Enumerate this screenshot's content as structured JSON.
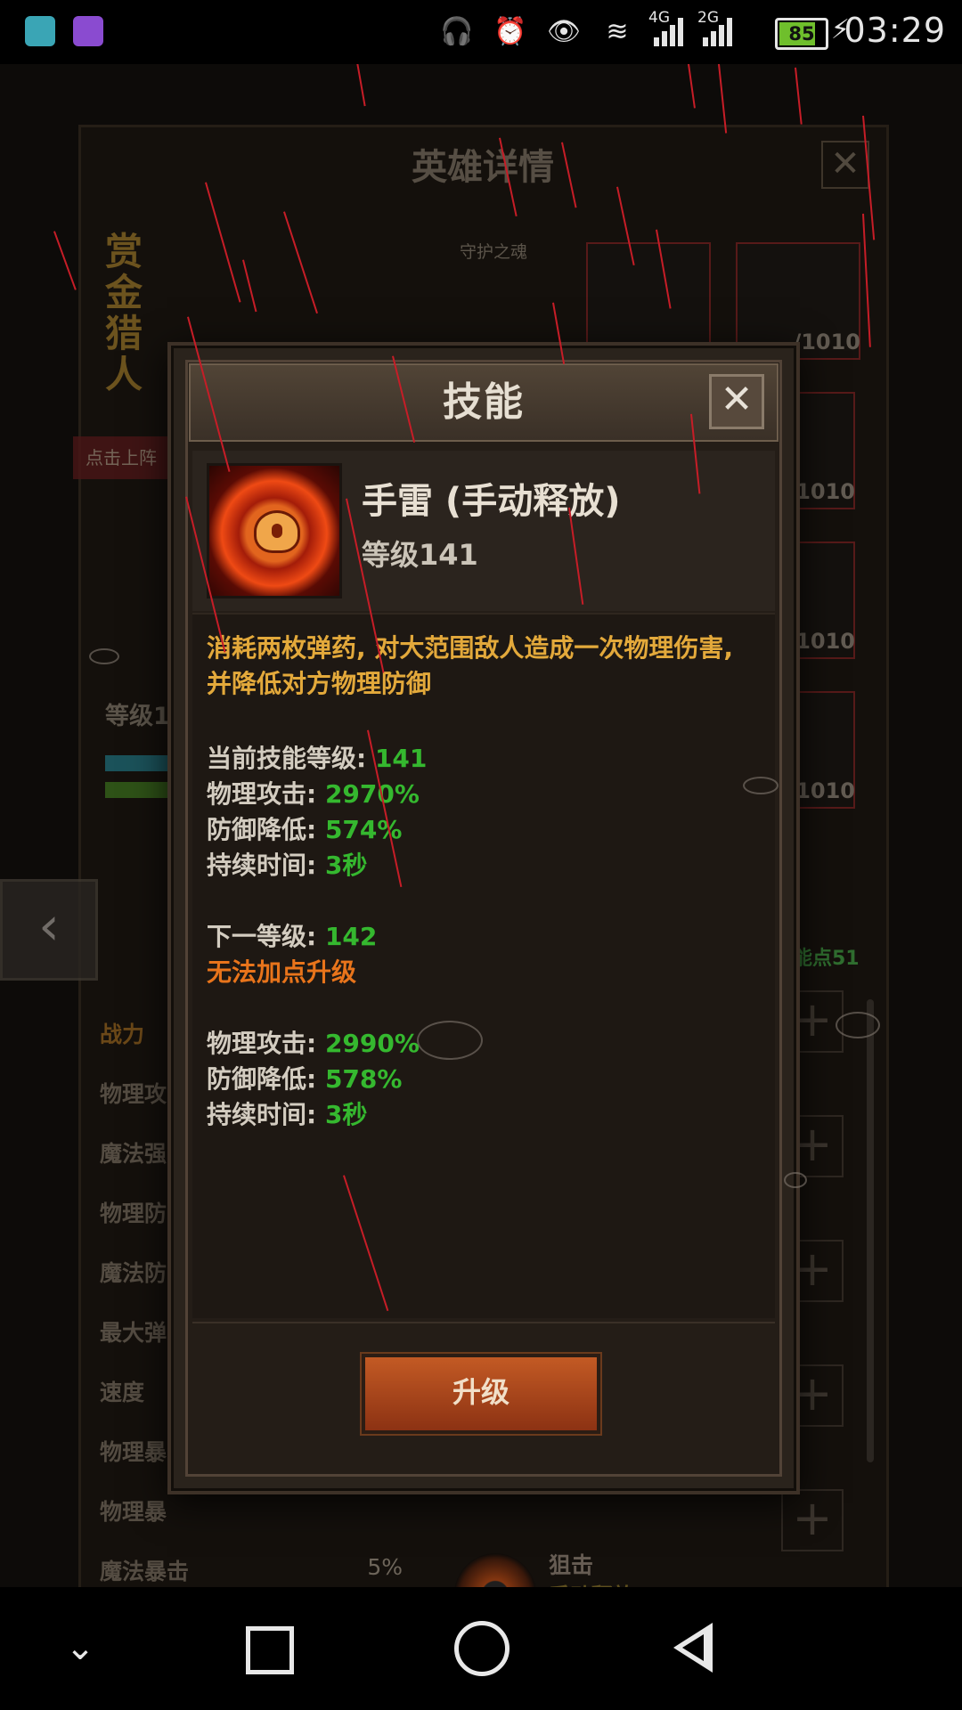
{
  "status_bar": {
    "network_4g": "4G",
    "network_2g": "2G",
    "battery_level": "85",
    "time": "03:29"
  },
  "background": {
    "panel_title": "英雄详情",
    "hero_name": "赏金猎人",
    "guardian_label": "守护之魂",
    "deploy_button": "点击上阵",
    "equipment_counts": [
      "/1010",
      "/1010",
      "/1010",
      "/1010"
    ],
    "level_label": "等级1",
    "skill_points": "能点51",
    "stats": [
      {
        "label": "战力",
        "value": ""
      },
      {
        "label": "物理攻",
        "value": ""
      },
      {
        "label": "魔法强",
        "value": ""
      },
      {
        "label": "物理防",
        "value": ""
      },
      {
        "label": "魔法防",
        "value": ""
      },
      {
        "label": "最大弹",
        "value": ""
      },
      {
        "label": "速度",
        "value": ""
      },
      {
        "label": "物理暴",
        "value": ""
      },
      {
        "label": "物理暴",
        "value": ""
      },
      {
        "label": "魔法暴击",
        "value": "5%"
      }
    ],
    "snipe_skill": {
      "name": "狙击",
      "mode": "手动释放"
    }
  },
  "dialog": {
    "title": "技能",
    "skill_name": "手雷 (手动释放)",
    "skill_level": "等级141",
    "description": "消耗两枚弹药, 对大范围敌人造成一次物理伤害, 并降低对方物理防御",
    "current": {
      "level_label": "当前技能等级: ",
      "level_value": "141",
      "phys_attack_label": "物理攻击: ",
      "phys_attack_value": "2970%",
      "def_reduce_label": "防御降低: ",
      "def_reduce_value": "574%",
      "duration_label": "持续时间: ",
      "duration_value": "3秒"
    },
    "next": {
      "level_label": "下一等级: ",
      "level_value": "142",
      "warning": "无法加点升级",
      "phys_attack_label": "物理攻击: ",
      "phys_attack_value": "2990%",
      "def_reduce_label": "防御降低: ",
      "def_reduce_value": "578%",
      "duration_label": "持续时间: ",
      "duration_value": "3秒"
    },
    "upgrade_button": "升级"
  },
  "colors": {
    "value_green": "#35b82f",
    "description_gold": "#e3a93b",
    "warning_orange": "#e8741b",
    "button_orange": "#c35a24",
    "rain_red": "#c61d27"
  }
}
